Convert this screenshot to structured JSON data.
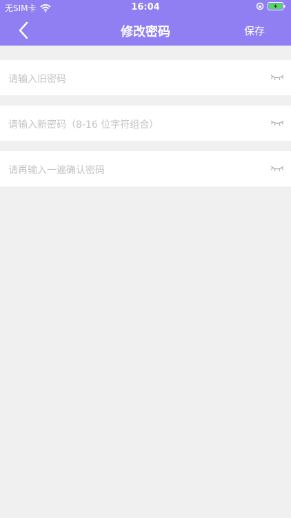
{
  "status_bar": {
    "carrier": "无SIM卡",
    "time": "16:04"
  },
  "nav": {
    "title": "修改密码",
    "save_label": "保存"
  },
  "fields": [
    {
      "placeholder": "请输入旧密码",
      "icon": "eye-closed-icon"
    },
    {
      "placeholder": "请输入新密码（8-16 位字符组合）",
      "icon": "eye-closed-icon"
    },
    {
      "placeholder": "请再输入一遍确认密码",
      "icon": "eye-closed-icon"
    }
  ],
  "colors": {
    "header": "#8f7ff3",
    "background": "#f0f0f0",
    "field_background": "#ffffff",
    "placeholder": "#c4c4c4",
    "icon": "#aaaaaa"
  }
}
